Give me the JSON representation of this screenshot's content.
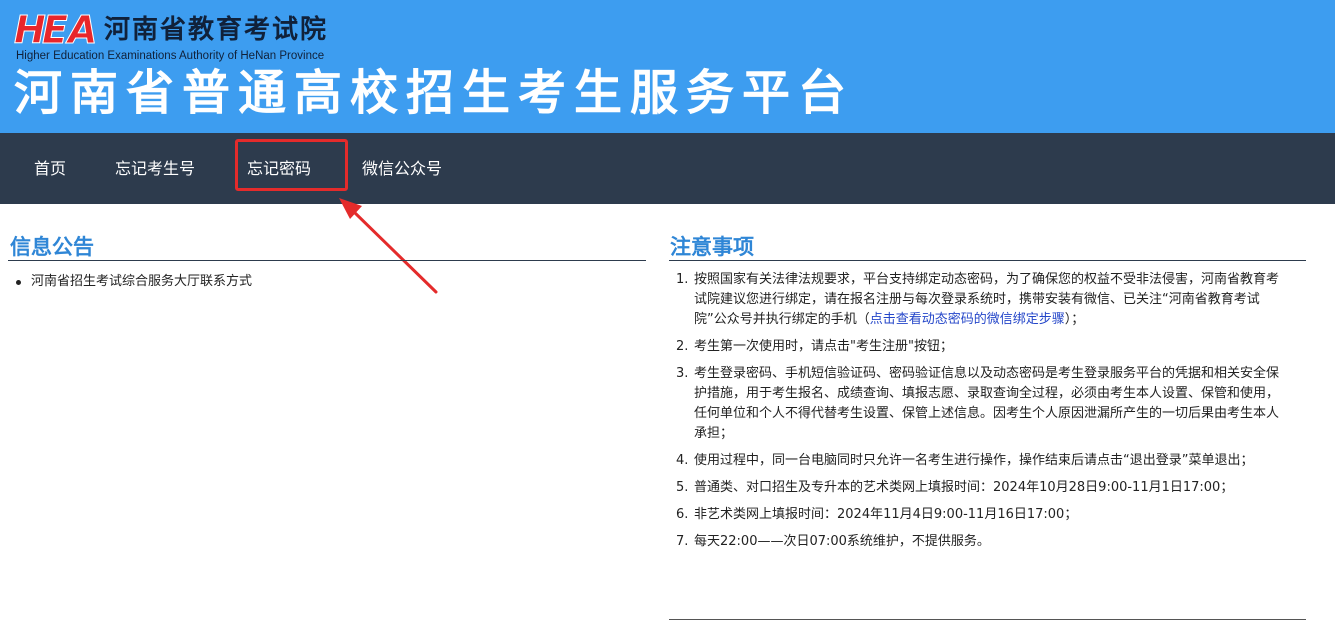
{
  "header": {
    "logo_letters": [
      "H",
      "E",
      "A"
    ],
    "org_name_cn": "河南省教育考试院",
    "org_name_en": "Higher Education Examinations Authority of HeNan Province",
    "platform_title": "河南省普通高校招生考生服务平台",
    "background_color": "#3d9df0"
  },
  "nav": {
    "background_color": "#2d3b4d",
    "items": [
      {
        "label": "首页"
      },
      {
        "label": "忘记考生号"
      },
      {
        "label": "忘记密码",
        "highlighted": true
      },
      {
        "label": "微信公众号"
      }
    ],
    "highlight_color": "#e42b2b"
  },
  "announcements": {
    "title": "信息公告",
    "items": [
      {
        "label": "河南省招生考试综合服务大厅联系方式"
      }
    ]
  },
  "notices": {
    "title": "注意事项",
    "items": [
      {
        "num": "1.",
        "text": "按照国家有关法律法规要求，平台支持绑定动态密码，为了确保您的权益不受非法侵害，河南省教育考试院建议您进行绑定，请在报名注册与每次登录系统时，携带安装有微信、已关注“河南省教育考试院”公众号并执行绑定的手机（",
        "link": "点击查看动态密码的微信绑定步骤",
        "after": "）；"
      },
      {
        "num": "2.",
        "text": "考生第一次使用时，请点击\"考生注册\"按钮；"
      },
      {
        "num": "3.",
        "text": "考生登录密码、手机短信验证码、密码验证信息以及动态密码是考生登录服务平台的凭据和相关安全保护措施，用于考生报名、成绩查询、填报志愿、录取查询全过程，必须由考生本人设置、保管和使用，任何单位和个人不得代替考生设置、保管上述信息。因考生个人原因泄漏所产生的一切后果由考生本人承担；"
      },
      {
        "num": "4.",
        "text": "使用过程中，同一台电脑同时只允许一名考生进行操作，操作结束后请点击“退出登录”菜单退出；"
      },
      {
        "num": "5.",
        "text": "普通类、对口招生及专升本的艺术类网上填报时间：2024年10月28日9:00-11月1日17:00；"
      },
      {
        "num": "6.",
        "text": "非艺术类网上填报时间：2024年11月4日9:00-11月16日17:00；"
      },
      {
        "num": "7.",
        "text": "每天22:00——次日07:00系统维护，不提供服务。"
      }
    ]
  },
  "annotation": {
    "arrow_color": "#e42b2b",
    "icon": "red-arrow-icon"
  }
}
